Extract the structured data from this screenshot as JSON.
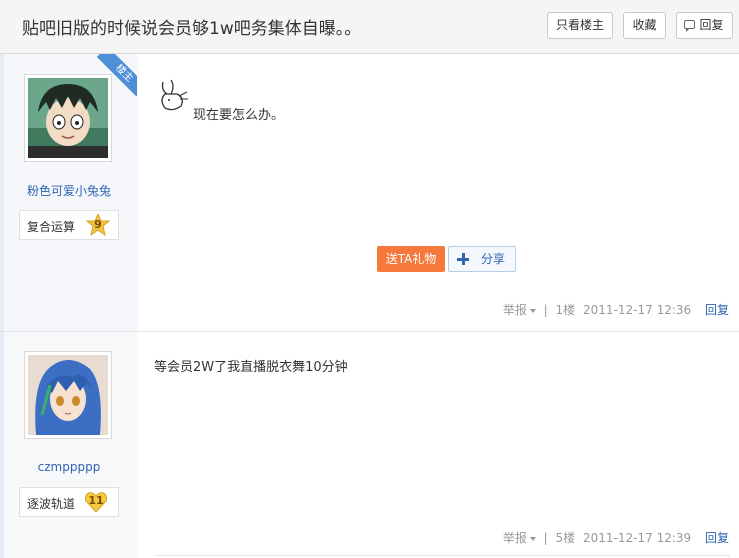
{
  "thread": {
    "title": "贴吧旧版的时候说会员够1w吧务集体自曝。。",
    "buttons": {
      "only_op": "只看楼主",
      "favorite": "收藏",
      "reply": "回复"
    }
  },
  "posts": [
    {
      "username": "粉色可爱小兔兔",
      "op_tag": "楼主",
      "level_name": "复合运算",
      "level_num": "9",
      "content": "现在要怎么办。",
      "gift_button": "送TA礼物",
      "share_button": "分享",
      "report": "举报",
      "floor": "1楼",
      "time": "2011-12-17 12:36",
      "reply": "回复",
      "badge_color": "#f3c443"
    },
    {
      "username": "czmppppp",
      "level_name": "逐波轨道",
      "level_num": "11",
      "content": "等会员2W了我直播脱衣舞10分钟",
      "report": "举报",
      "floor": "5楼",
      "time": "2011-12-17 12:39",
      "reply": "回复",
      "badge_color": "#f5c842"
    }
  ],
  "colors": {
    "link": "#2d64b3",
    "gift": "#f5793a",
    "op_tag": "#4e8fd8"
  }
}
